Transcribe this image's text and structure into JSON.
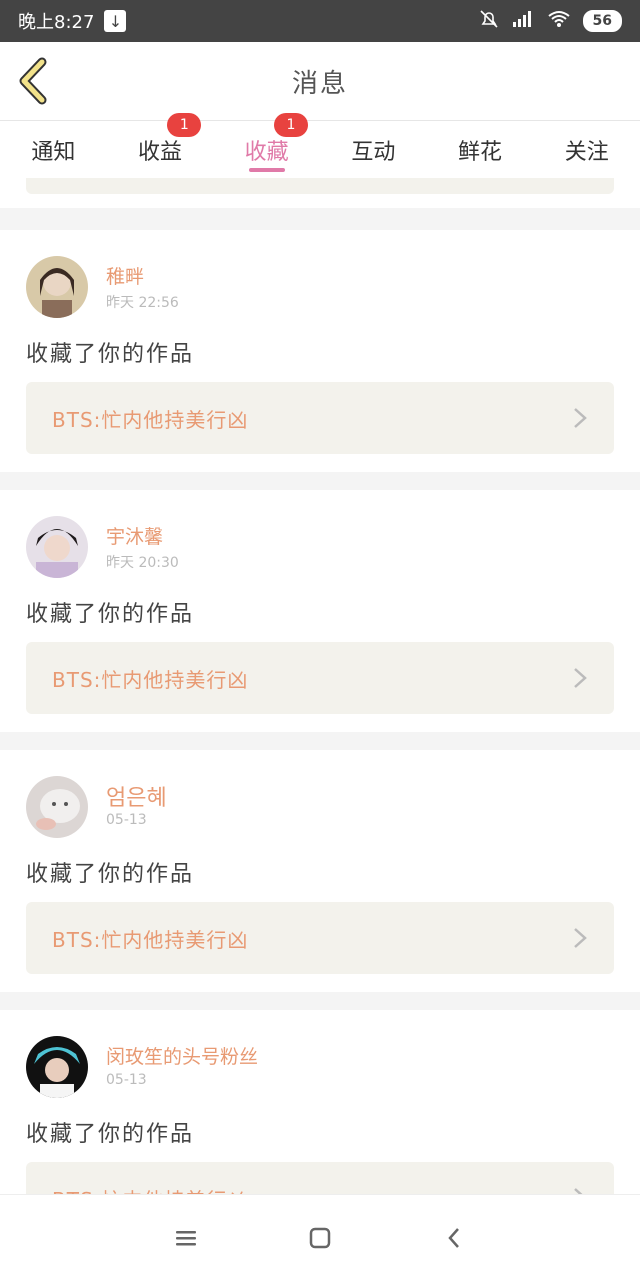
{
  "status_bar": {
    "time": "晚上8:27",
    "battery": "56",
    "icons": [
      "download-icon",
      "bell-off-icon",
      "signal-icon",
      "wifi-icon"
    ]
  },
  "header": {
    "title": "消息"
  },
  "tabs": [
    {
      "label": "通知",
      "badge": "",
      "active": false
    },
    {
      "label": "收益",
      "badge": "1",
      "active": false
    },
    {
      "label": "收藏",
      "badge": "1",
      "active": true
    },
    {
      "label": "互动",
      "badge": "",
      "active": false
    },
    {
      "label": "鲜花",
      "badge": "",
      "active": false
    },
    {
      "label": "关注",
      "badge": "",
      "active": false
    }
  ],
  "items": [
    {
      "username": "稚畔",
      "time": "昨天 22:56",
      "action": "收藏了你的作品",
      "work": "BTS:忙内他持美行凶"
    },
    {
      "username": "宇沐馨",
      "time": "昨天 20:30",
      "action": "收藏了你的作品",
      "work": "BTS:忙内他持美行凶"
    },
    {
      "username": "엄은혜",
      "time": "05-13",
      "action": "收藏了你的作品",
      "work": "BTS:忙内他持美行凶"
    },
    {
      "username": "闵玫笙的头号粉丝",
      "time": "05-13",
      "action": "收藏了你的作品",
      "work": "BTS:忙内他持美行凶"
    }
  ],
  "colors": {
    "accent": "#e07aa8",
    "username": "#e89a73",
    "badge": "#e8423f",
    "link_bg": "#f3f2ec",
    "back_arrow": "#f2e28a"
  }
}
